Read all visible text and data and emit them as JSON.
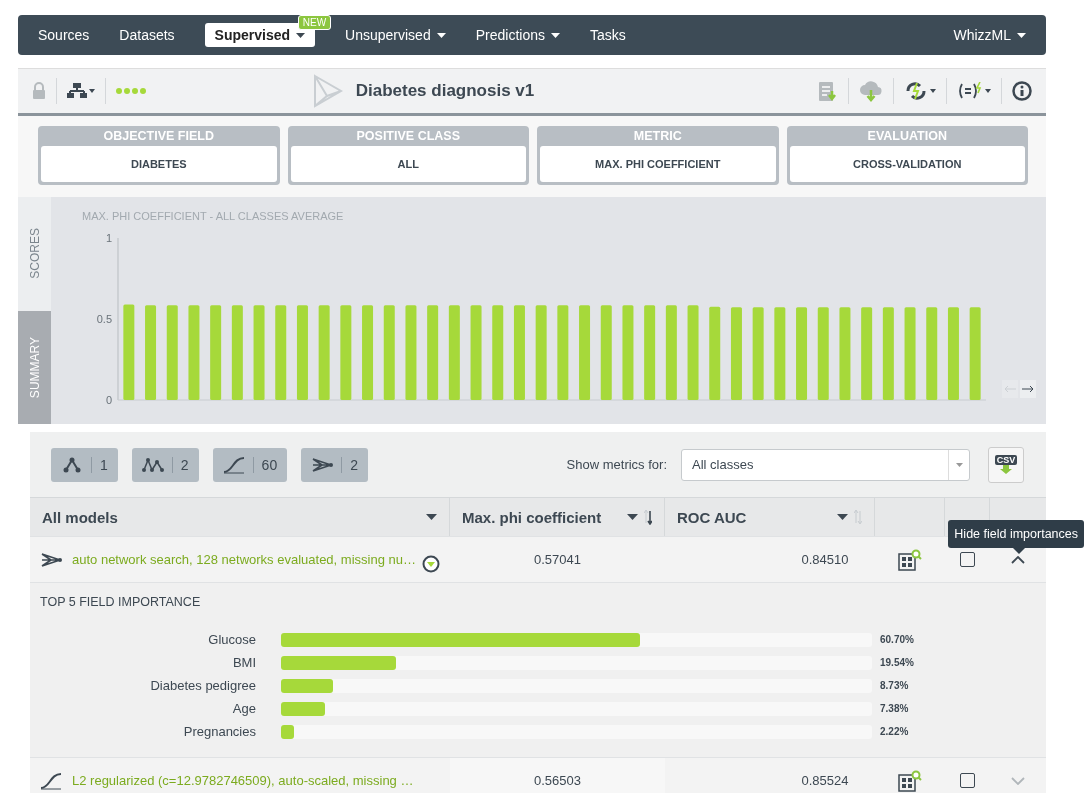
{
  "nav": {
    "items": [
      {
        "label": "Sources",
        "dropdown": false,
        "selected": false
      },
      {
        "label": "Datasets",
        "dropdown": false,
        "selected": false
      },
      {
        "label": "Supervised",
        "dropdown": true,
        "selected": true,
        "badge": "NEW"
      },
      {
        "label": "Unsupervised",
        "dropdown": true,
        "selected": false
      },
      {
        "label": "Predictions",
        "dropdown": true,
        "selected": false
      },
      {
        "label": "Tasks",
        "dropdown": false,
        "selected": false
      }
    ],
    "right": {
      "label": "WhizzML",
      "dropdown": true
    }
  },
  "toolbar": {
    "title": "Diabetes diagnosis v1"
  },
  "settings": [
    {
      "label": "OBJECTIVE FIELD",
      "value": "DIABETES"
    },
    {
      "label": "POSITIVE CLASS",
      "value": "ALL"
    },
    {
      "label": "METRIC",
      "value": "MAX. PHI COEFFICIENT"
    },
    {
      "label": "EVALUATION",
      "value": "CROSS-VALIDATION"
    }
  ],
  "side_tabs": [
    {
      "label": "SCORES",
      "selected": true
    },
    {
      "label": "SUMMARY",
      "selected": false
    }
  ],
  "chart": {
    "scroll_left_disabled": true,
    "scroll_right_disabled": false,
    "chart_data": {
      "type": "bar",
      "title": "MAX. PHI COEFFICIENT - ALL CLASSES AVERAGE",
      "ylim": [
        0,
        1
      ],
      "yticks": [
        0,
        0.5,
        1
      ],
      "values": [
        0.59,
        0.585,
        0.585,
        0.585,
        0.585,
        0.585,
        0.585,
        0.585,
        0.585,
        0.585,
        0.585,
        0.585,
        0.585,
        0.585,
        0.585,
        0.585,
        0.585,
        0.585,
        0.585,
        0.585,
        0.585,
        0.585,
        0.585,
        0.585,
        0.585,
        0.585,
        0.585,
        0.575,
        0.572,
        0.572,
        0.572,
        0.572,
        0.572,
        0.572,
        0.572,
        0.572,
        0.572,
        0.572,
        0.572,
        0.572
      ]
    }
  },
  "model_filters": [
    {
      "kind": "ensemble",
      "count": "1"
    },
    {
      "kind": "ensembles",
      "count": "2"
    },
    {
      "kind": "logistic",
      "count": "60"
    },
    {
      "kind": "network",
      "count": "2"
    }
  ],
  "metrics_filter": {
    "label": "Show metrics for:",
    "value": "All classes"
  },
  "export": {
    "label": "CSV"
  },
  "table": {
    "columns": [
      {
        "label": "All models",
        "dropdown": true
      },
      {
        "label": "Max. phi coefficient",
        "dropdown": true,
        "sorted": true
      },
      {
        "label": "ROC AUC",
        "dropdown": true,
        "sorted": false
      }
    ],
    "rows": [
      {
        "kind": "network",
        "name": "auto network search, 128 networks evaluated, missing nu…",
        "phi": "0.57041",
        "roc": "0.84510",
        "checked": false,
        "expanded": true,
        "importance": {
          "title": "TOP 5 FIELD IMPORTANCE",
          "fields": [
            {
              "name": "Glucose",
              "level": 0.607,
              "reading": "60.70%"
            },
            {
              "name": "BMI",
              "level": 0.1954,
              "reading": "19.54%"
            },
            {
              "name": "Diabetes pedigree",
              "level": 0.0873,
              "reading": "8.73%"
            },
            {
              "name": "Age",
              "level": 0.0738,
              "reading": "7.38%"
            },
            {
              "name": "Pregnancies",
              "level": 0.0222,
              "reading": "2.22%"
            }
          ]
        }
      },
      {
        "kind": "logistic",
        "name": "L2 regularized (c=12.9782746509), auto-scaled, missing …",
        "phi": "0.56503",
        "roc": "0.85524",
        "checked": false,
        "expanded": false
      }
    ]
  },
  "tooltip": "Hide field importances"
}
